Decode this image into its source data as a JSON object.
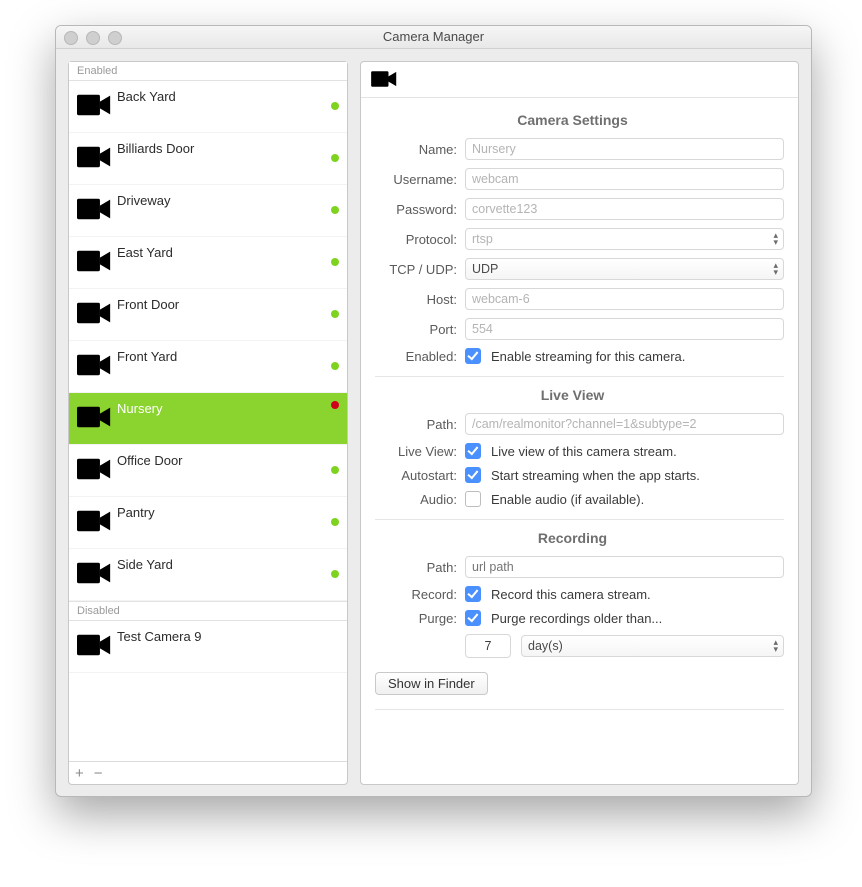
{
  "window": {
    "title": "Camera Manager"
  },
  "sidebar": {
    "sections": {
      "enabled": "Enabled",
      "disabled": "Disabled"
    },
    "enabled_items": [
      {
        "name": "Back Yard",
        "status": "ok",
        "selected": false
      },
      {
        "name": "Billiards Door",
        "status": "ok",
        "selected": false
      },
      {
        "name": "Driveway",
        "status": "ok",
        "selected": false
      },
      {
        "name": "East Yard",
        "status": "ok",
        "selected": false
      },
      {
        "name": "Front Door",
        "status": "ok",
        "selected": false
      },
      {
        "name": "Front Yard",
        "status": "ok",
        "selected": false
      },
      {
        "name": "Nursery",
        "status": "err",
        "selected": true
      },
      {
        "name": "Office Door",
        "status": "ok",
        "selected": false
      },
      {
        "name": "Pantry",
        "status": "ok",
        "selected": false
      },
      {
        "name": "Side Yard",
        "status": "ok",
        "selected": false
      }
    ],
    "disabled_items": [
      {
        "name": "Test Camera 9"
      }
    ],
    "toolbar": {
      "add": "+",
      "remove": "−"
    }
  },
  "settings": {
    "section1_title": "Camera Settings",
    "name": {
      "label": "Name:",
      "value": "Nursery"
    },
    "username": {
      "label": "Username:",
      "value": "webcam"
    },
    "password": {
      "label": "Password:",
      "value": "corvette123"
    },
    "protocol": {
      "label": "Protocol:",
      "value": "rtsp"
    },
    "tcpudp": {
      "label": "TCP / UDP:",
      "value": "UDP"
    },
    "host": {
      "label": "Host:",
      "value": "webcam-6"
    },
    "port": {
      "label": "Port:",
      "value": "554"
    },
    "enabled": {
      "label": "Enabled:",
      "checked": true,
      "text": "Enable streaming for this camera."
    },
    "section2_title": "Live View",
    "lv_path": {
      "label": "Path:",
      "value": "/cam/realmonitor?channel=1&subtype=2"
    },
    "liveview": {
      "label": "Live View:",
      "checked": true,
      "text": "Live view of this camera stream."
    },
    "autostart": {
      "label": "Autostart:",
      "checked": true,
      "text": "Start streaming when the app starts."
    },
    "audio": {
      "label": "Audio:",
      "checked": false,
      "text": "Enable audio (if available)."
    },
    "section3_title": "Recording",
    "rec_path": {
      "label": "Path:",
      "placeholder": "url path"
    },
    "record": {
      "label": "Record:",
      "checked": true,
      "text": "Record this camera stream."
    },
    "purge": {
      "label": "Purge:",
      "checked": true,
      "text": "Purge recordings older than...",
      "count": "7",
      "unit": "day(s)"
    },
    "finder_btn": "Show in Finder"
  }
}
